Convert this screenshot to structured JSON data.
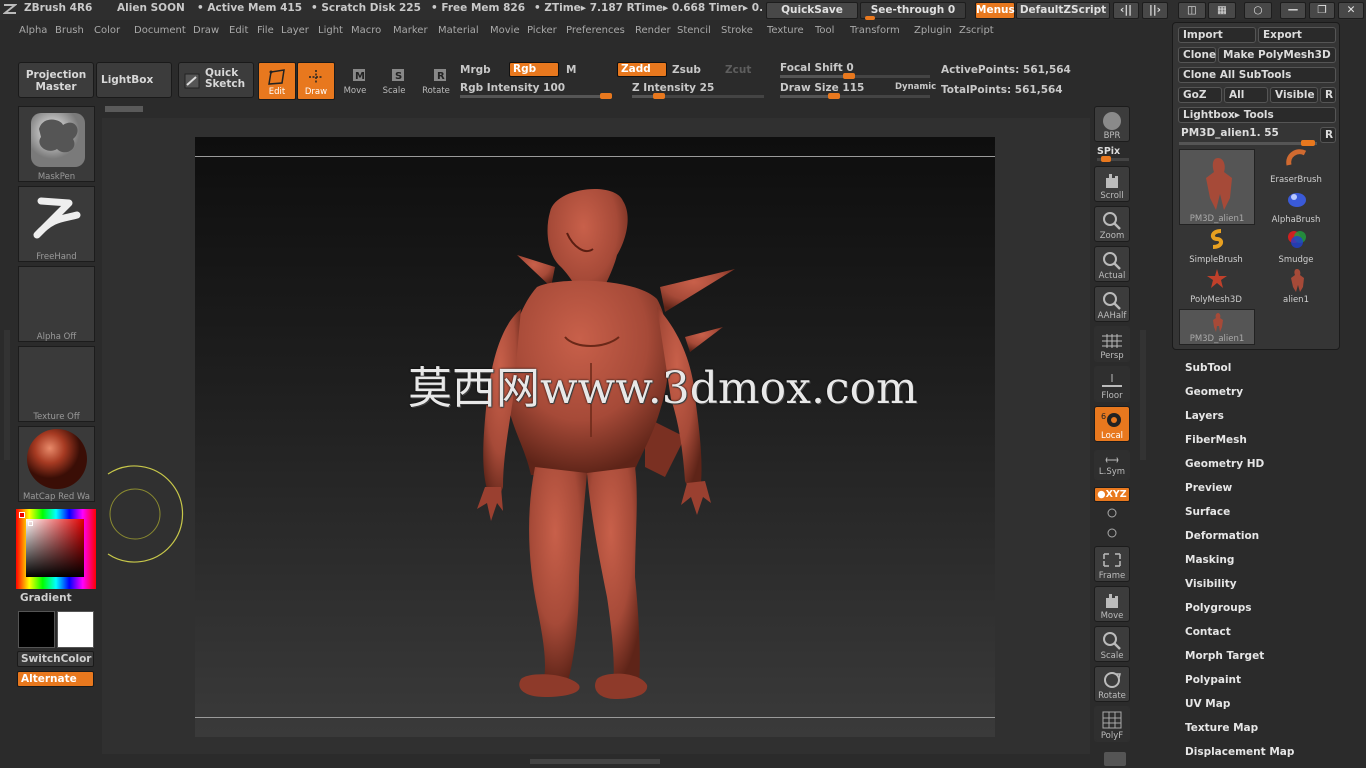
{
  "titlebar": {
    "app": "ZBrush 4R6",
    "project": "Alien SOON",
    "active_mem": "• Active Mem 415",
    "scratch": "• Scratch Disk 225",
    "free_mem": "• Free Mem 826",
    "ztime": "• ZTime▸ 7.187 RTime▸ 0.668 Timer▸ 0.",
    "quicksave": "QuickSave",
    "seethrough": "See-through  0",
    "menus": "Menus",
    "zscript": "DefaultZScript"
  },
  "menubar": [
    "Alpha",
    "Brush",
    "Color",
    "Document",
    "Draw",
    "Edit",
    "File",
    "Layer",
    "Light",
    "Macro",
    "Marker",
    "Material",
    "Movie",
    "Picker",
    "Preferences",
    "Render",
    "Stencil",
    "Stroke",
    "Texture",
    "Tool",
    "Transform",
    "Zplugin",
    "Zscript"
  ],
  "toolbar": {
    "projection_master_1": "Projection",
    "projection_master_2": "Master",
    "lightbox": "LightBox",
    "quick_sketch_1": "Quick",
    "quick_sketch_2": "Sketch",
    "edit": "Edit",
    "draw": "Draw",
    "move": "Move",
    "scale": "Scale",
    "rotate": "Rotate",
    "mrgb": "Mrgb",
    "rgb": "Rgb",
    "m": "M",
    "rgb_intensity": "Rgb Intensity 100",
    "zadd": "Zadd",
    "zsub": "Zsub",
    "zcut": "Zcut",
    "z_intensity": "Z Intensity 25",
    "focal_shift": "Focal Shift 0",
    "draw_size": "Draw Size 115",
    "dynamic": "Dynamic",
    "active_points": "ActivePoints: 561,564",
    "total_points": "TotalPoints: 561,564",
    "rgb_intensity_level": 1.0,
    "z_intensity_level": 0.25,
    "focal_shift_level": 0.5,
    "draw_size_level": 0.4
  },
  "leftshelf": {
    "brush": "MaskPen",
    "stroke": "FreeHand",
    "alpha": "Alpha  Off",
    "texture": "Texture  Off",
    "material": "MatCap  Red  Wa",
    "gradient": "Gradient",
    "switchcolor": "SwitchColor",
    "alternate": "Alternate"
  },
  "watermark": "莫西网www.3dmox.com",
  "rightshelf": {
    "bpr": "BPR",
    "spix": "SPix",
    "scroll": "Scroll",
    "zoom": "Zoom",
    "actual": "Actual",
    "aahalf": "AAHalf",
    "persp": "Persp",
    "floor": "Floor",
    "local": "Local",
    "lsym": "L.Sym",
    "xyz": "●XYZ",
    "frame": "Frame",
    "move": "Move",
    "scale": "Scale",
    "rotate": "Rotate",
    "polyf": "PolyF"
  },
  "toolpanel": {
    "import": "Import",
    "export": "Export",
    "clone": "Clone",
    "make_polymesh": "Make PolyMesh3D",
    "clone_all": "Clone  All  SubTools",
    "goz": "GoZ",
    "all": "All",
    "visible": "Visible",
    "r": "R",
    "lightbox_tools": "Lightbox▸ Tools",
    "current_tool": "PM3D_alien1. 55",
    "r2": "R",
    "slots": [
      "PM3D_alien1",
      "EraserBrush",
      "AlphaBrush",
      "SimpleBrush",
      "Smudge",
      "PolyMesh3D",
      "alien1",
      "PM3D_alien1"
    ]
  },
  "submenu": [
    "SubTool",
    "Geometry",
    "Layers",
    "FiberMesh",
    "Geometry HD",
    "Preview",
    "Surface",
    "Deformation",
    "Masking",
    "Visibility",
    "Polygroups",
    "Contact",
    "Morph Target",
    "Polypaint",
    "UV Map",
    "Texture Map",
    "Displacement Map"
  ],
  "colors": {
    "accent": "#e8781e",
    "model": "#a64a38",
    "background": "#2b2b2b"
  }
}
